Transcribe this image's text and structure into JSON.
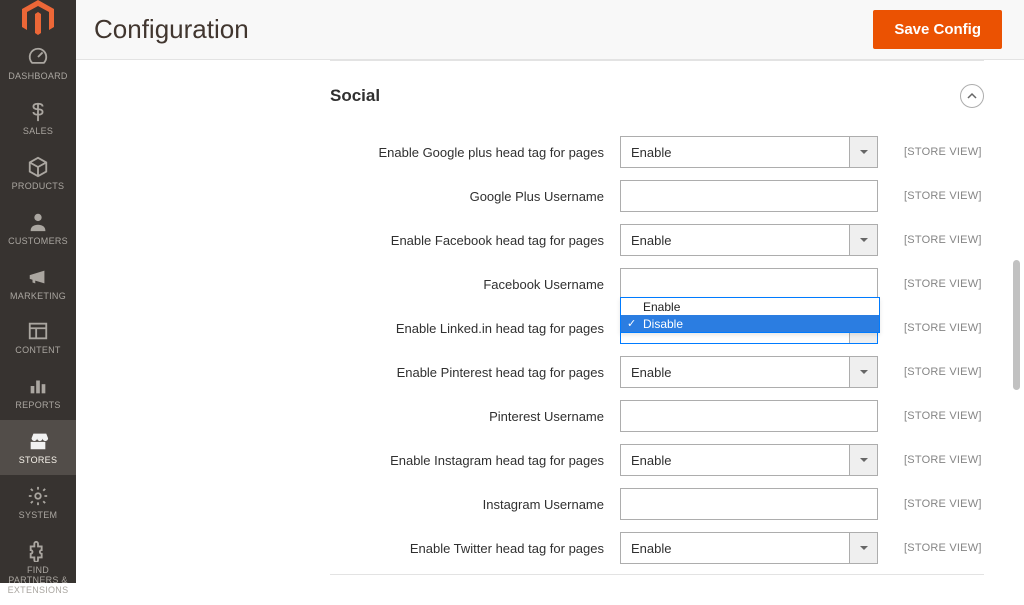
{
  "page": {
    "title": "Configuration",
    "save_button": "Save Config"
  },
  "sidebar": {
    "items": [
      {
        "label": "DASHBOARD"
      },
      {
        "label": "SALES"
      },
      {
        "label": "PRODUCTS"
      },
      {
        "label": "CUSTOMERS"
      },
      {
        "label": "MARKETING"
      },
      {
        "label": "CONTENT"
      },
      {
        "label": "REPORTS"
      },
      {
        "label": "STORES"
      },
      {
        "label": "SYSTEM"
      },
      {
        "label": "FIND PARTNERS & EXTENSIONS"
      }
    ]
  },
  "section": {
    "title": "Social",
    "scope_label": "[STORE VIEW]",
    "dropdown_options": [
      "Enable",
      "Disable"
    ],
    "fields": [
      {
        "label": "Enable Google plus head tag for pages",
        "type": "select",
        "value": "Enable"
      },
      {
        "label": "Google Plus Username",
        "type": "text",
        "value": ""
      },
      {
        "label": "Enable Facebook head tag for pages",
        "type": "select",
        "value": "Enable"
      },
      {
        "label": "Facebook Username",
        "type": "text",
        "value": ""
      },
      {
        "label": "Enable Linked.in head tag for pages",
        "type": "select",
        "value": "Disable",
        "open": true
      },
      {
        "label": "Enable Pinterest head tag for pages",
        "type": "select",
        "value": "Enable"
      },
      {
        "label": "Pinterest Username",
        "type": "text",
        "value": ""
      },
      {
        "label": "Enable Instagram head tag for pages",
        "type": "select",
        "value": "Enable"
      },
      {
        "label": "Instagram Username",
        "type": "text",
        "value": ""
      },
      {
        "label": "Enable Twitter head tag for pages",
        "type": "select",
        "value": "Enable"
      }
    ]
  }
}
